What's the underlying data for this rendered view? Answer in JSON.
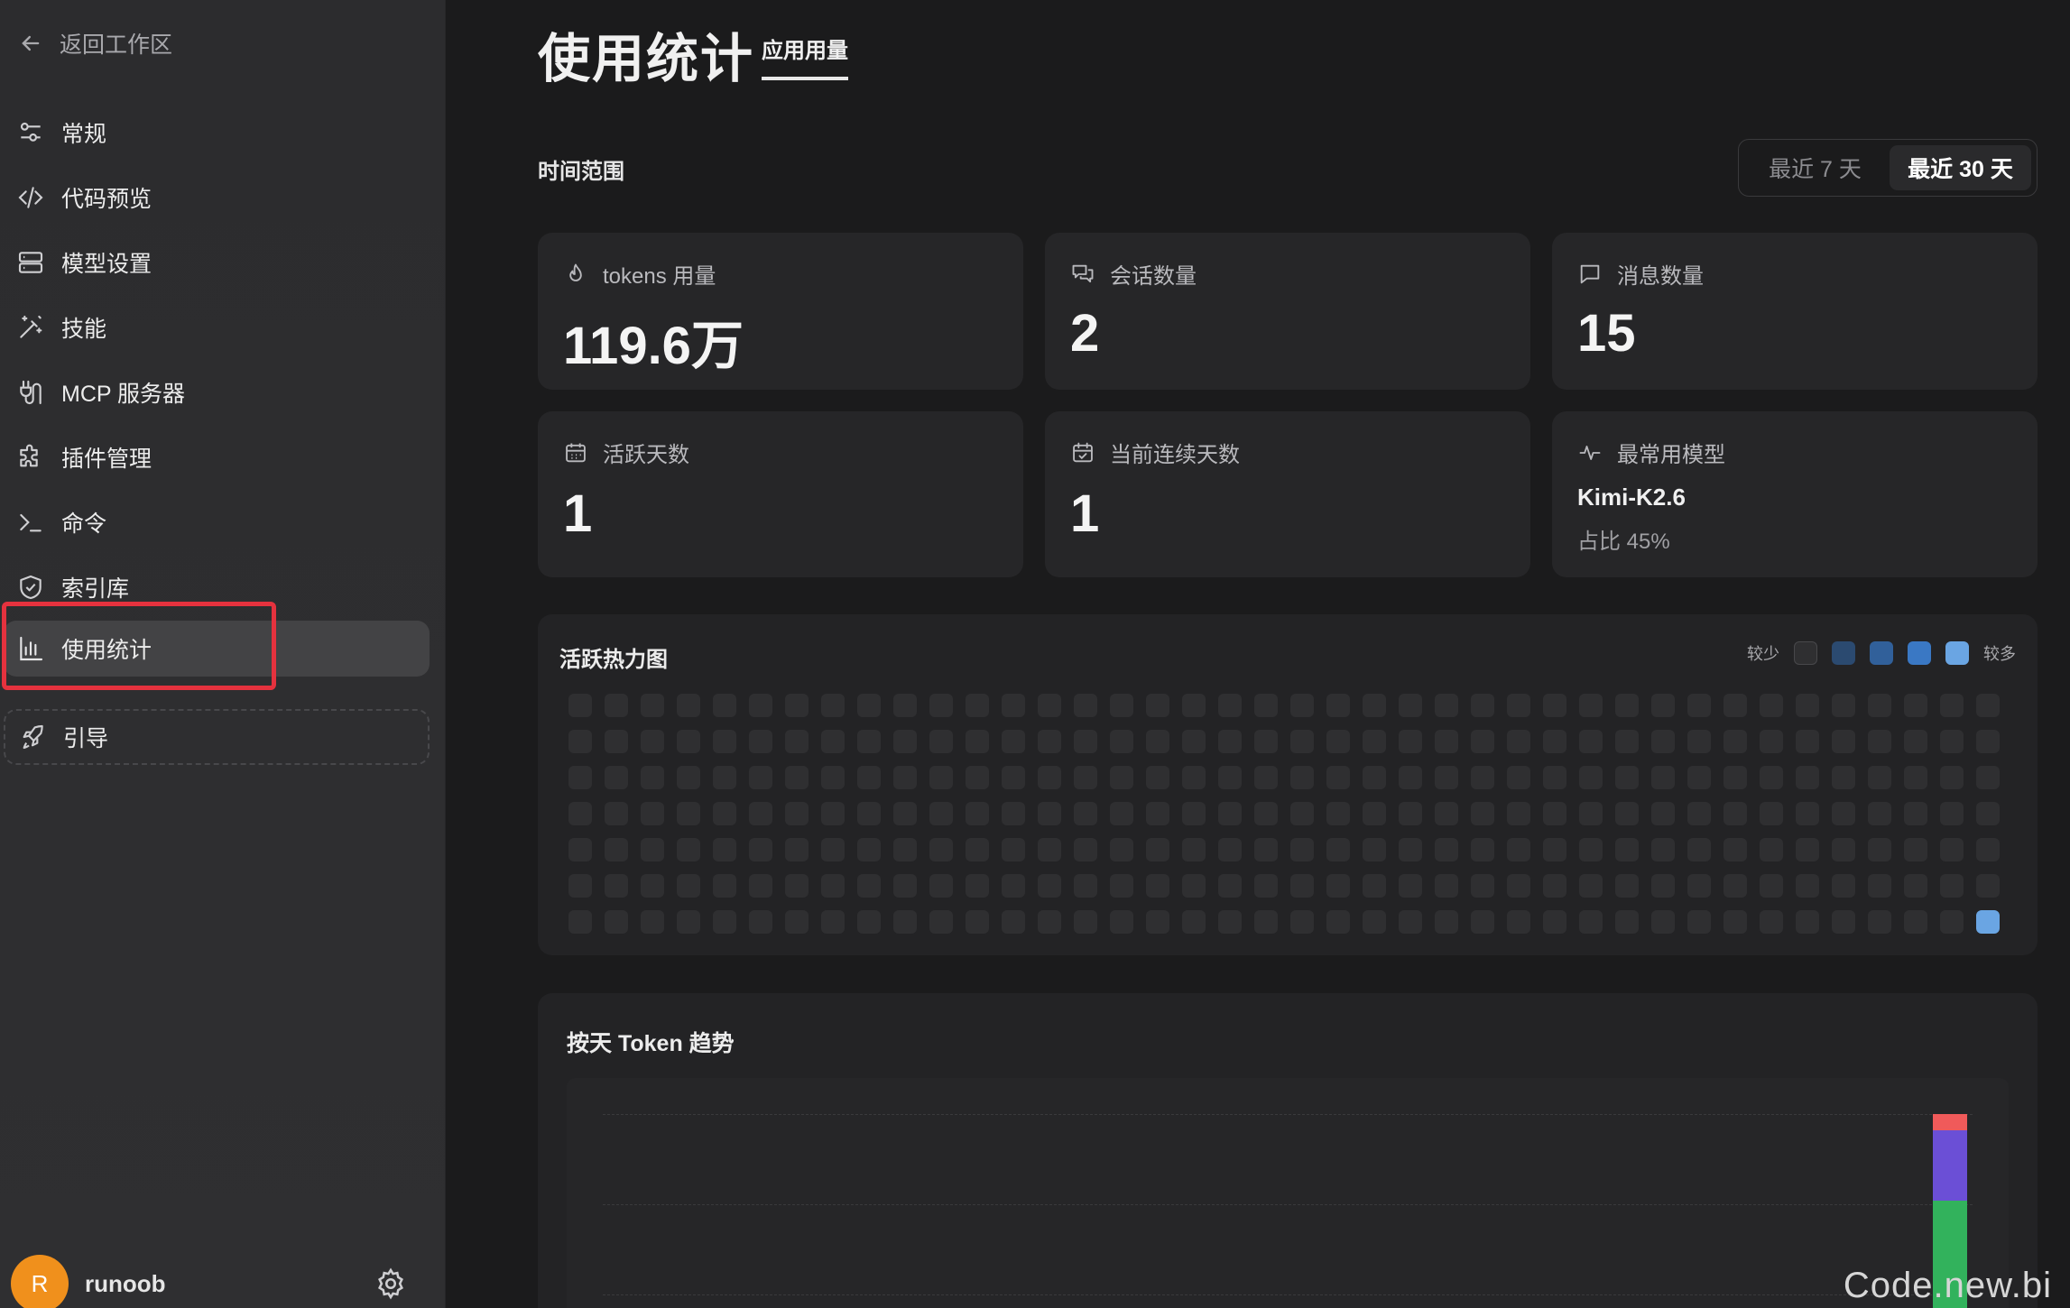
{
  "sidebar": {
    "back_label": "返回工作区",
    "items": [
      {
        "label": "常规",
        "icon": "sliders-icon"
      },
      {
        "label": "代码预览",
        "icon": "code-icon"
      },
      {
        "label": "模型设置",
        "icon": "server-icon"
      },
      {
        "label": "技能",
        "icon": "magic-wand-icon"
      },
      {
        "label": "MCP 服务器",
        "icon": "plug-icon"
      },
      {
        "label": "插件管理",
        "icon": "puzzle-icon"
      },
      {
        "label": "命令",
        "icon": "terminal-icon"
      },
      {
        "label": "索引库",
        "icon": "shield-icon"
      },
      {
        "label": "使用统计",
        "icon": "bar-chart-icon",
        "active": true
      },
      {
        "label": "引导",
        "icon": "rocket-icon"
      }
    ],
    "user": {
      "initial": "R",
      "name": "runoob"
    }
  },
  "header": {
    "title": "使用统计",
    "tab_label": "应用用量"
  },
  "range": {
    "label": "时间范围",
    "options": [
      "最近 7 天",
      "最近 30 天"
    ],
    "selected": "最近 30 天"
  },
  "stats": {
    "tokens": {
      "label": "tokens 用量",
      "value": "119.6万"
    },
    "sessions": {
      "label": "会话数量",
      "value": "2"
    },
    "messages": {
      "label": "消息数量",
      "value": "15"
    },
    "active_days": {
      "label": "活跃天数",
      "value": "1"
    },
    "streak": {
      "label": "当前连续天数",
      "value": "1"
    },
    "top_model": {
      "label": "最常用模型",
      "name": "Kimi-K2.6",
      "share": "占比 45%"
    }
  },
  "heatmap": {
    "title": "活跃热力图",
    "legend_less": "较少",
    "legend_more": "较多",
    "legend_colors": [
      "#2f2f31",
      "#2b4a70",
      "#31609a",
      "#3a78c4",
      "#6aa5e3"
    ],
    "columns": 40,
    "rows": 7,
    "active_cell": {
      "column": 40,
      "row": 7,
      "level": 4
    }
  },
  "trend": {
    "title": "按天 Token 趋势",
    "colors": {
      "red": "#f05a5a",
      "purple": "#6b4fd6",
      "green": "#32b25c"
    }
  },
  "watermark": "Code.new.bi"
}
